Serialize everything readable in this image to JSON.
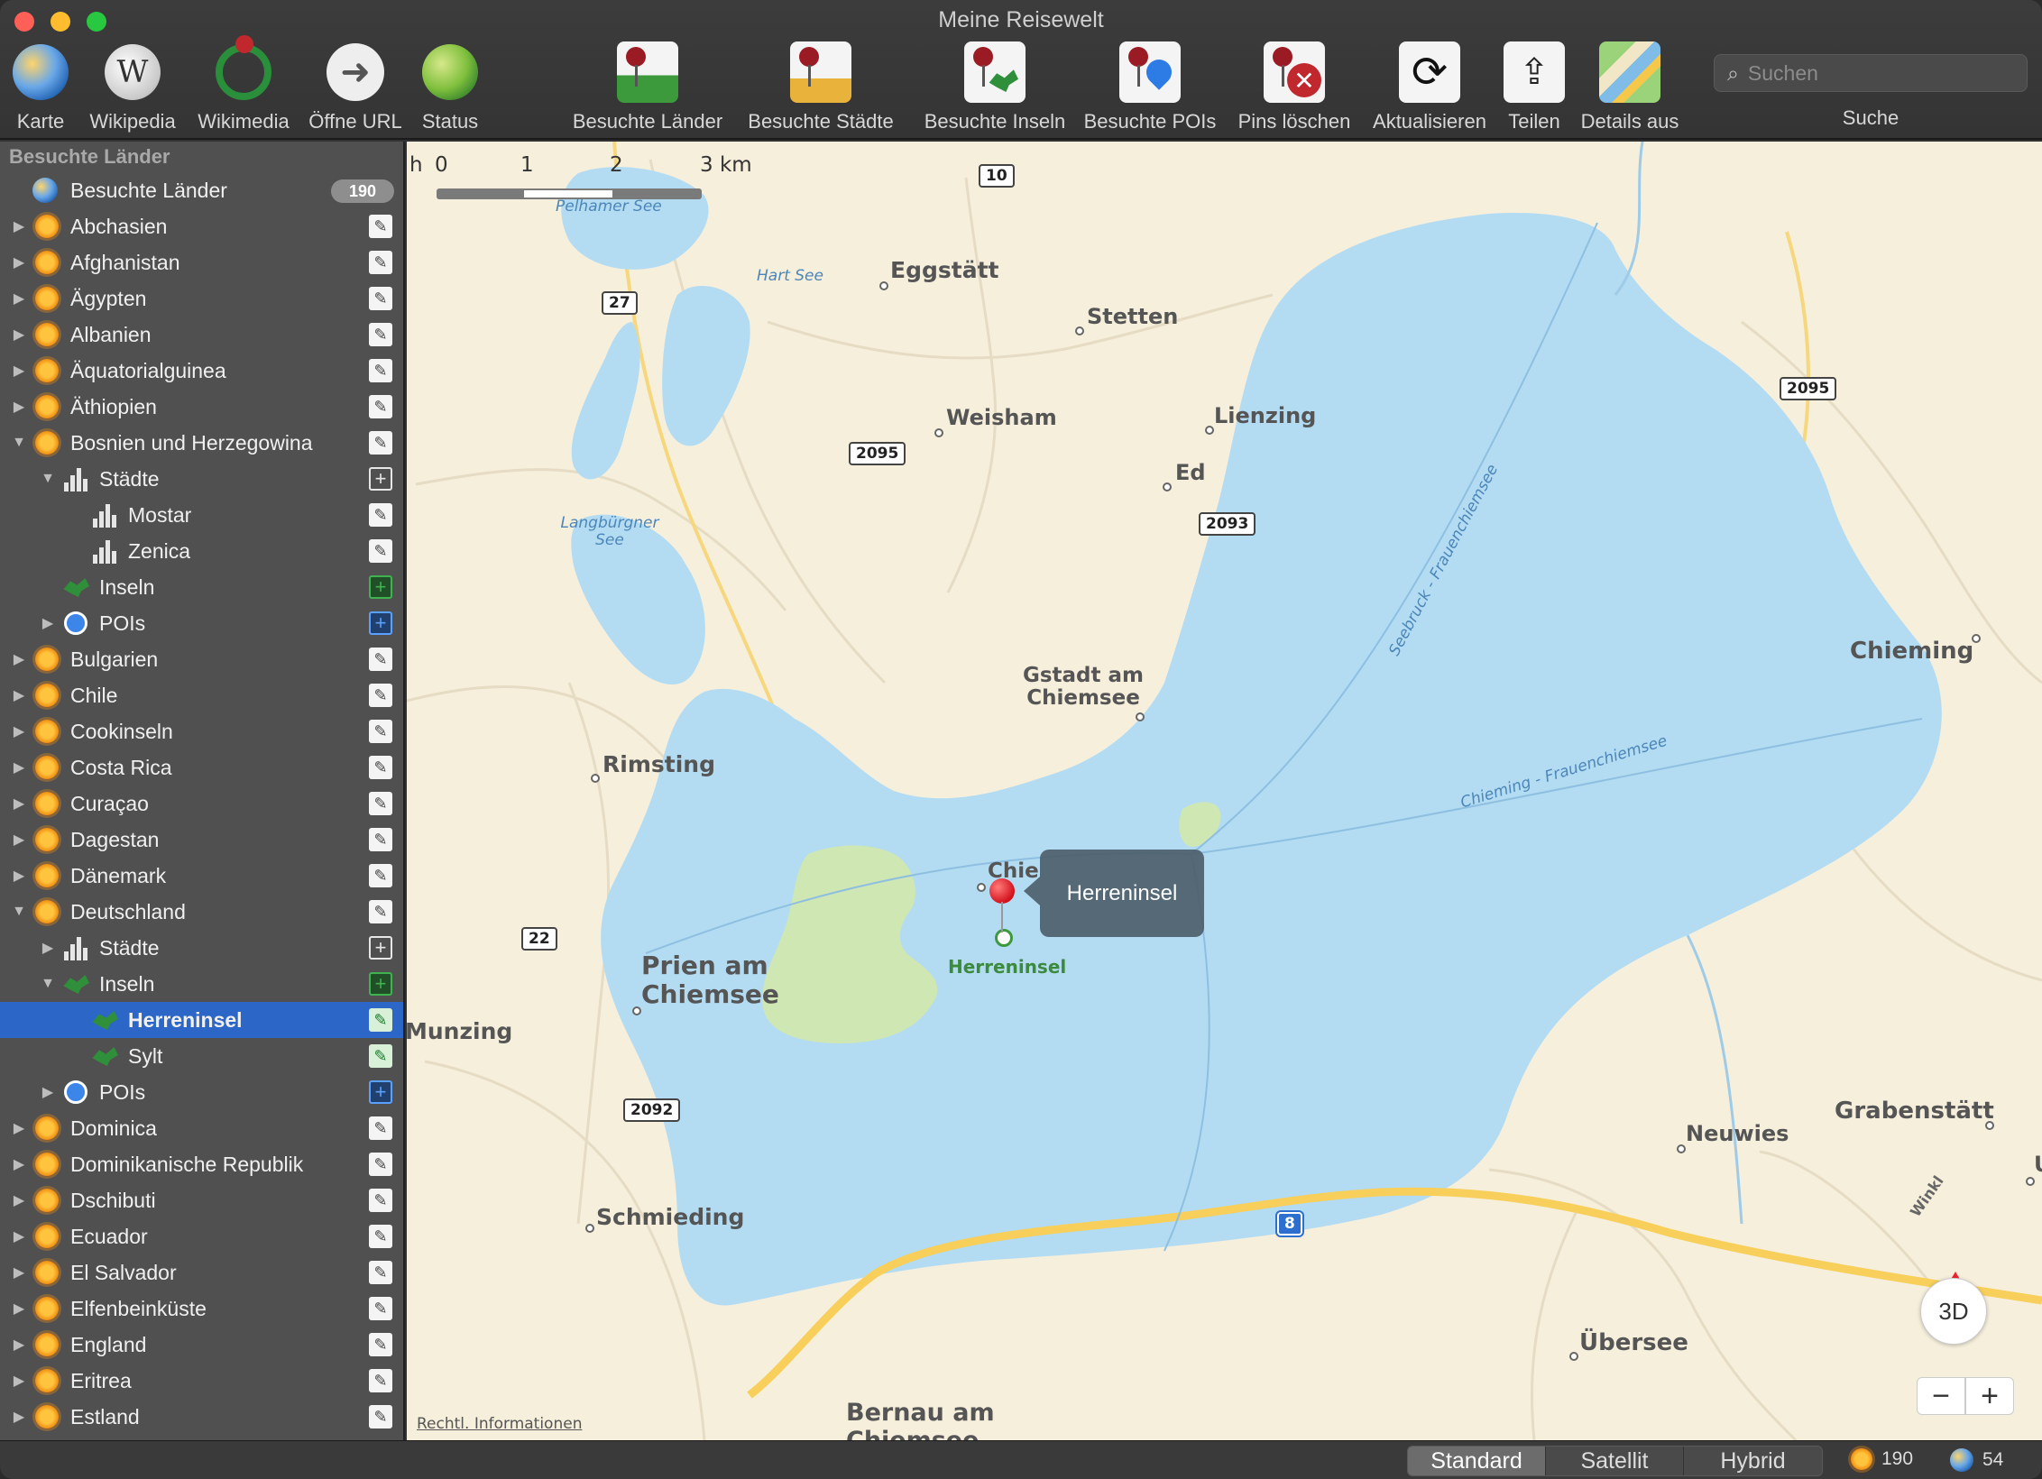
{
  "window": {
    "title": "Meine Reisewelt"
  },
  "toolbar": {
    "buttons": [
      {
        "label": "Karte",
        "icon": "globe-icon"
      },
      {
        "label": "Wikipedia",
        "icon": "wikipedia-icon"
      },
      {
        "label": "Wikimedia",
        "icon": "wikimedia-icon"
      },
      {
        "label": "Öffne URL",
        "icon": "arrow-right-icon"
      },
      {
        "label": "Status",
        "icon": "status-globe-icon"
      },
      {
        "label": "Besuchte Länder",
        "icon": "pin-country-icon"
      },
      {
        "label": "Besuchte Städte",
        "icon": "pin-city-icon"
      },
      {
        "label": "Besuchte Inseln",
        "icon": "pin-island-icon"
      },
      {
        "label": "Besuchte POIs",
        "icon": "pin-poi-icon"
      },
      {
        "label": "Pins löschen",
        "icon": "pin-delete-icon"
      },
      {
        "label": "Aktualisieren",
        "icon": "refresh-icon"
      },
      {
        "label": "Teilen",
        "icon": "share-icon"
      },
      {
        "label": "Details aus",
        "icon": "map-details-icon"
      }
    ],
    "search": {
      "placeholder": "Suchen",
      "label": "Suche"
    }
  },
  "sidebar": {
    "header": "Besuchte Länder",
    "total": {
      "label": "Besuchte Länder",
      "count": "190"
    },
    "rows": [
      {
        "label": "Abchasien",
        "level": 0,
        "kind": "country",
        "disc": "closed",
        "action": "edit"
      },
      {
        "label": "Afghanistan",
        "level": 0,
        "kind": "country",
        "disc": "closed",
        "action": "edit"
      },
      {
        "label": "Ägypten",
        "level": 0,
        "kind": "country",
        "disc": "closed",
        "action": "edit"
      },
      {
        "label": "Albanien",
        "level": 0,
        "kind": "country",
        "disc": "closed",
        "action": "edit"
      },
      {
        "label": "Äquatorialguinea",
        "level": 0,
        "kind": "country",
        "disc": "closed",
        "action": "edit"
      },
      {
        "label": "Äthiopien",
        "level": 0,
        "kind": "country",
        "disc": "closed",
        "action": "edit"
      },
      {
        "label": "Bosnien und Herzegowina",
        "level": 0,
        "kind": "country",
        "disc": "open",
        "action": "edit"
      },
      {
        "label": "Städte",
        "level": 1,
        "kind": "cities",
        "disc": "open",
        "action": "add"
      },
      {
        "label": "Mostar",
        "level": 2,
        "kind": "city",
        "disc": "none",
        "action": "edit"
      },
      {
        "label": "Zenica",
        "level": 2,
        "kind": "city",
        "disc": "none",
        "action": "edit"
      },
      {
        "label": "Inseln",
        "level": 1,
        "kind": "islands",
        "disc": "none",
        "action": "add-green"
      },
      {
        "label": "POIs",
        "level": 1,
        "kind": "pois",
        "disc": "closed",
        "action": "add-blue"
      },
      {
        "label": "Bulgarien",
        "level": 0,
        "kind": "country",
        "disc": "closed",
        "action": "edit"
      },
      {
        "label": "Chile",
        "level": 0,
        "kind": "country",
        "disc": "closed",
        "action": "edit"
      },
      {
        "label": "Cookinseln",
        "level": 0,
        "kind": "country",
        "disc": "closed",
        "action": "edit"
      },
      {
        "label": "Costa Rica",
        "level": 0,
        "kind": "country",
        "disc": "closed",
        "action": "edit"
      },
      {
        "label": "Curaçao",
        "level": 0,
        "kind": "country",
        "disc": "closed",
        "action": "edit"
      },
      {
        "label": "Dagestan",
        "level": 0,
        "kind": "country",
        "disc": "closed",
        "action": "edit"
      },
      {
        "label": "Dänemark",
        "level": 0,
        "kind": "country",
        "disc": "closed",
        "action": "edit"
      },
      {
        "label": "Deutschland",
        "level": 0,
        "kind": "country",
        "disc": "open",
        "action": "edit"
      },
      {
        "label": "Städte",
        "level": 1,
        "kind": "cities",
        "disc": "closed",
        "action": "add"
      },
      {
        "label": "Inseln",
        "level": 1,
        "kind": "islands",
        "disc": "open",
        "action": "add-green"
      },
      {
        "label": "Herreninsel",
        "level": 2,
        "kind": "island",
        "disc": "none",
        "action": "edit-green",
        "selected": true
      },
      {
        "label": "Sylt",
        "level": 2,
        "kind": "island",
        "disc": "none",
        "action": "edit-green"
      },
      {
        "label": "POIs",
        "level": 1,
        "kind": "pois",
        "disc": "closed",
        "action": "add-blue"
      },
      {
        "label": "Dominica",
        "level": 0,
        "kind": "country",
        "disc": "closed",
        "action": "edit"
      },
      {
        "label": "Dominikanische Republik",
        "level": 0,
        "kind": "country",
        "disc": "closed",
        "action": "edit"
      },
      {
        "label": "Dschibuti",
        "level": 0,
        "kind": "country",
        "disc": "closed",
        "action": "edit"
      },
      {
        "label": "Ecuador",
        "level": 0,
        "kind": "country",
        "disc": "closed",
        "action": "edit"
      },
      {
        "label": "El Salvador",
        "level": 0,
        "kind": "country",
        "disc": "closed",
        "action": "edit"
      },
      {
        "label": "Elfenbeinküste",
        "level": 0,
        "kind": "country",
        "disc": "closed",
        "action": "edit"
      },
      {
        "label": "England",
        "level": 0,
        "kind": "country",
        "disc": "closed",
        "action": "edit"
      },
      {
        "label": "Eritrea",
        "level": 0,
        "kind": "country",
        "disc": "closed",
        "action": "edit"
      },
      {
        "label": "Estland",
        "level": 0,
        "kind": "country",
        "disc": "closed",
        "action": "edit"
      }
    ]
  },
  "map": {
    "scale": {
      "labels": [
        "0",
        "1",
        "2",
        "3 km"
      ],
      "clipped_prefix": "h"
    },
    "places": [
      "Eggstätt",
      "Stetten",
      "Weisham",
      "Lienzing",
      "Ed",
      "Gstadt am Chiemsee",
      "Rimsting",
      "Chieming",
      "Prien am Chiemsee",
      "Munzing",
      "Neuwies",
      "Grabenstätt",
      "Schmieding",
      "Übersee",
      "Bernau am Chiemsee",
      "Chie",
      "Herreninsel"
    ],
    "lakes": [
      "Pelhamer See",
      "Hart See",
      "Langbürgner See"
    ],
    "ferries": [
      "Seebruck - Frauenchiemsee",
      "Chieming - Frauenchiemsee"
    ],
    "roads": [
      "10",
      "27",
      "2095",
      "2093",
      "2095",
      "22",
      "2092",
      "8"
    ],
    "road_label_winkl": "Winkl",
    "edge_letter": "U",
    "callout": "Herreninsel",
    "compass": "3D",
    "zoom_out": "−",
    "zoom_in": "+",
    "legal": "Rechtl. Informationen",
    "colors": {
      "water": "#b3dcf3",
      "land": "#f6efdc",
      "island": "#cfe7b3",
      "highway": "#f7cf5a",
      "pin": "#d3111b"
    }
  },
  "statusbar": {
    "map_types": [
      "Standard",
      "Satellit",
      "Hybrid"
    ],
    "active_map_type": "Standard",
    "countries_count": "190",
    "world_count": "54"
  }
}
